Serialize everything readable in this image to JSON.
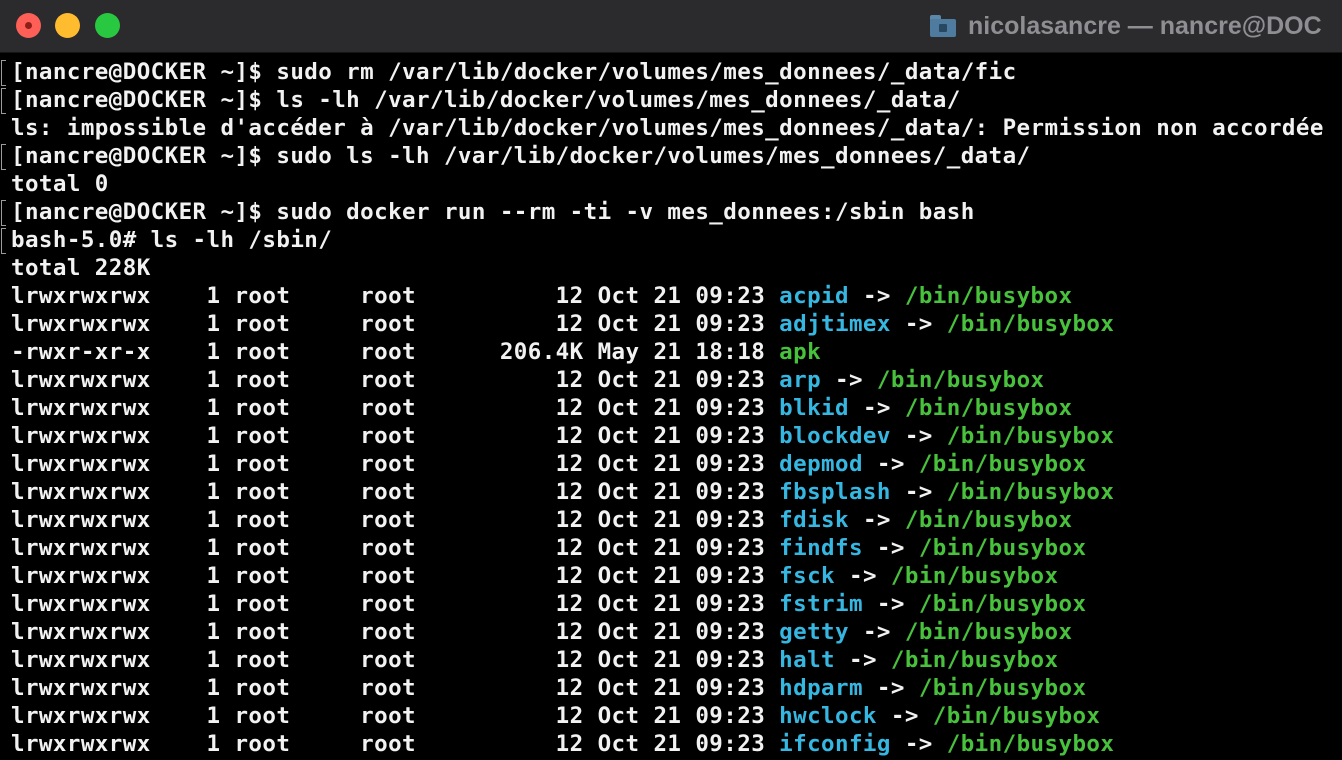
{
  "window": {
    "title": "nicolasancre — nancre@DOC",
    "folder_icon": "folder-icon"
  },
  "colors": {
    "background": "#000000",
    "text": "#f2f2f2",
    "symlink": "#36b7e2",
    "executable": "#48c13c"
  },
  "prompt_lines": [
    {
      "text": "[nancre@DOCKER ~]$ sudo rm /var/lib/docker/volumes/mes_donnees/_data/fic"
    },
    {
      "text": "[nancre@DOCKER ~]$ ls -lh /var/lib/docker/volumes/mes_donnees/_data/"
    },
    {
      "text": "ls: impossible d'accéder à /var/lib/docker/volumes/mes_donnees/_data/: Permission non accordée"
    },
    {
      "text": "[nancre@DOCKER ~]$ sudo ls -lh /var/lib/docker/volumes/mes_donnees/_data/"
    },
    {
      "text": "total 0"
    },
    {
      "text": "[nancre@DOCKER ~]$ sudo docker run --rm -ti -v mes_donnees:/sbin bash"
    },
    {
      "text": "bash-5.0# ls -lh /sbin/"
    },
    {
      "text": "total 228K"
    }
  ],
  "listing": [
    {
      "meta": "lrwxrwxrwx    1 root     root          12 Oct 21 09:23 ",
      "name": "acpid",
      "arrow": " -> ",
      "target": "/bin/busybox"
    },
    {
      "meta": "lrwxrwxrwx    1 root     root          12 Oct 21 09:23 ",
      "name": "adjtimex",
      "arrow": " -> ",
      "target": "/bin/busybox"
    },
    {
      "meta": "-rwxr-xr-x    1 root     root      206.4K May 21 18:18 ",
      "name": "apk",
      "arrow": "",
      "target": ""
    },
    {
      "meta": "lrwxrwxrwx    1 root     root          12 Oct 21 09:23 ",
      "name": "arp",
      "arrow": " -> ",
      "target": "/bin/busybox"
    },
    {
      "meta": "lrwxrwxrwx    1 root     root          12 Oct 21 09:23 ",
      "name": "blkid",
      "arrow": " -> ",
      "target": "/bin/busybox"
    },
    {
      "meta": "lrwxrwxrwx    1 root     root          12 Oct 21 09:23 ",
      "name": "blockdev",
      "arrow": " -> ",
      "target": "/bin/busybox"
    },
    {
      "meta": "lrwxrwxrwx    1 root     root          12 Oct 21 09:23 ",
      "name": "depmod",
      "arrow": " -> ",
      "target": "/bin/busybox"
    },
    {
      "meta": "lrwxrwxrwx    1 root     root          12 Oct 21 09:23 ",
      "name": "fbsplash",
      "arrow": " -> ",
      "target": "/bin/busybox"
    },
    {
      "meta": "lrwxrwxrwx    1 root     root          12 Oct 21 09:23 ",
      "name": "fdisk",
      "arrow": " -> ",
      "target": "/bin/busybox"
    },
    {
      "meta": "lrwxrwxrwx    1 root     root          12 Oct 21 09:23 ",
      "name": "findfs",
      "arrow": " -> ",
      "target": "/bin/busybox"
    },
    {
      "meta": "lrwxrwxrwx    1 root     root          12 Oct 21 09:23 ",
      "name": "fsck",
      "arrow": " -> ",
      "target": "/bin/busybox"
    },
    {
      "meta": "lrwxrwxrwx    1 root     root          12 Oct 21 09:23 ",
      "name": "fstrim",
      "arrow": " -> ",
      "target": "/bin/busybox"
    },
    {
      "meta": "lrwxrwxrwx    1 root     root          12 Oct 21 09:23 ",
      "name": "getty",
      "arrow": " -> ",
      "target": "/bin/busybox"
    },
    {
      "meta": "lrwxrwxrwx    1 root     root          12 Oct 21 09:23 ",
      "name": "halt",
      "arrow": " -> ",
      "target": "/bin/busybox"
    },
    {
      "meta": "lrwxrwxrwx    1 root     root          12 Oct 21 09:23 ",
      "name": "hdparm",
      "arrow": " -> ",
      "target": "/bin/busybox"
    },
    {
      "meta": "lrwxrwxrwx    1 root     root          12 Oct 21 09:23 ",
      "name": "hwclock",
      "arrow": " -> ",
      "target": "/bin/busybox"
    },
    {
      "meta": "lrwxrwxrwx    1 root     root          12 Oct 21 09:23 ",
      "name": "ifconfig",
      "arrow": " -> ",
      "target": "/bin/busybox"
    }
  ]
}
